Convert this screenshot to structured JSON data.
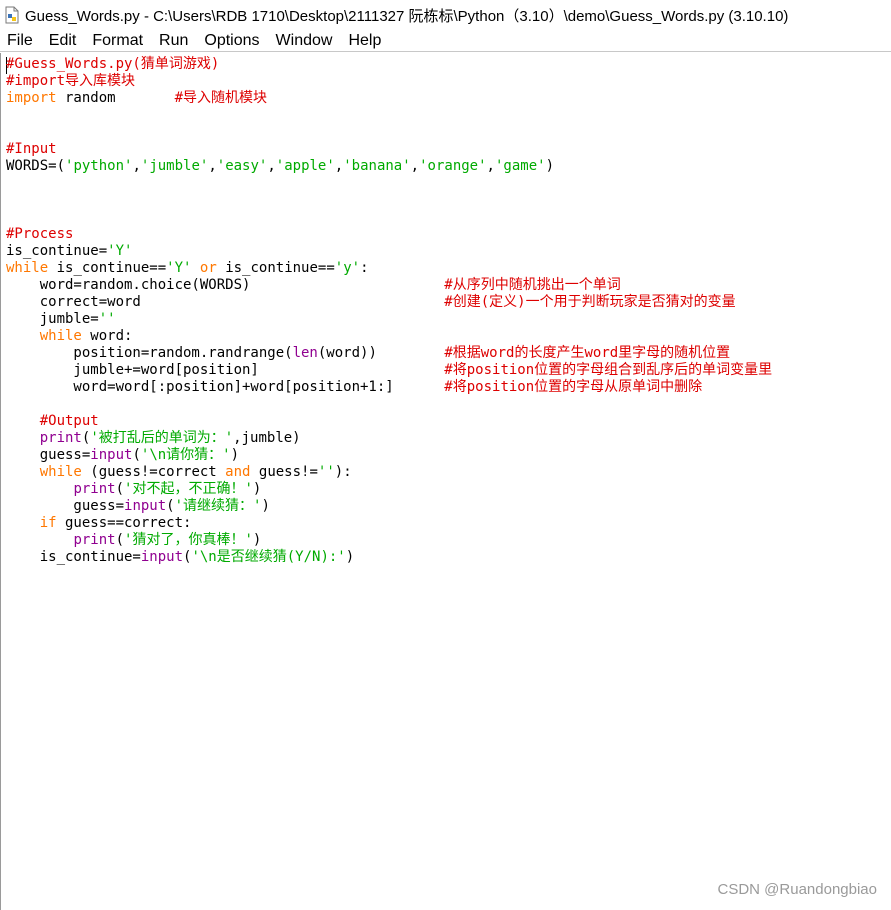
{
  "window": {
    "title": "Guess_Words.py - C:\\Users\\RDB    1710\\Desktop\\2111327 阮栋标\\Python（3.10）\\demo\\Guess_Words.py (3.10.10)",
    "icon": "python-file-icon"
  },
  "menu": [
    "File",
    "Edit",
    "Format",
    "Run",
    "Options",
    "Window",
    "Help"
  ],
  "code_lines": [
    [
      [
        "cm",
        "#Guess_Words.py(猜单词游戏)"
      ]
    ],
    [
      [
        "cm",
        "#import导入库模块"
      ]
    ],
    [
      [
        "kw",
        "import"
      ],
      [
        "df",
        " random       "
      ],
      [
        "cm",
        "#导入随机模块"
      ]
    ],
    [],
    [],
    [
      [
        "cm",
        "#Input"
      ]
    ],
    [
      [
        "df",
        "WORDS=("
      ],
      [
        "st",
        "'python'"
      ],
      [
        "df",
        ","
      ],
      [
        "st",
        "'jumble'"
      ],
      [
        "df",
        ","
      ],
      [
        "st",
        "'easy'"
      ],
      [
        "df",
        ","
      ],
      [
        "st",
        "'apple'"
      ],
      [
        "df",
        ","
      ],
      [
        "st",
        "'banana'"
      ],
      [
        "df",
        ","
      ],
      [
        "st",
        "'orange'"
      ],
      [
        "df",
        ","
      ],
      [
        "st",
        "'game'"
      ],
      [
        "df",
        ")"
      ]
    ],
    [],
    [],
    [],
    [
      [
        "cm",
        "#Process"
      ]
    ],
    [
      [
        "df",
        "is_continue="
      ],
      [
        "st",
        "'Y'"
      ]
    ],
    [
      [
        "kw",
        "while"
      ],
      [
        "df",
        " is_continue=="
      ],
      [
        "st",
        "'Y'"
      ],
      [
        "df",
        " "
      ],
      [
        "kw",
        "or"
      ],
      [
        "df",
        " is_continue=="
      ],
      [
        "st",
        "'y'"
      ],
      [
        "df",
        ":"
      ]
    ],
    [
      [
        "df",
        "    word=random.choice(WORDS)                       "
      ],
      [
        "cm",
        "#从序列中随机挑出一个单词"
      ]
    ],
    [
      [
        "df",
        "    correct=word                                    "
      ],
      [
        "cm",
        "#创建(定义)一个用于判断玩家是否猜对的变量"
      ]
    ],
    [
      [
        "df",
        "    jumble="
      ],
      [
        "st",
        "''"
      ]
    ],
    [
      [
        "df",
        "    "
      ],
      [
        "kw",
        "while"
      ],
      [
        "df",
        " word:"
      ]
    ],
    [
      [
        "df",
        "        position=random.randrange("
      ],
      [
        "bi",
        "len"
      ],
      [
        "df",
        "(word))        "
      ],
      [
        "cm",
        "#根据word的长度产生word里字母的随机位置"
      ]
    ],
    [
      [
        "df",
        "        jumble+=word[position]                      "
      ],
      [
        "cm",
        "#将position位置的字母组合到乱序后的单词变量里"
      ]
    ],
    [
      [
        "df",
        "        word=word[:position]+word[position+1:]      "
      ],
      [
        "cm",
        "#将position位置的字母从原单词中删除"
      ]
    ],
    [],
    [
      [
        "df",
        "    "
      ],
      [
        "cm",
        "#Output"
      ]
    ],
    [
      [
        "df",
        "    "
      ],
      [
        "bi",
        "print"
      ],
      [
        "df",
        "("
      ],
      [
        "st",
        "'被打乱后的单词为：'"
      ],
      [
        "df",
        ",jumble)"
      ]
    ],
    [
      [
        "df",
        "    guess="
      ],
      [
        "bi",
        "input"
      ],
      [
        "df",
        "("
      ],
      [
        "st",
        "'\\n请你猜：'"
      ],
      [
        "df",
        ")"
      ]
    ],
    [
      [
        "df",
        "    "
      ],
      [
        "kw",
        "while"
      ],
      [
        "df",
        " (guess!=correct "
      ],
      [
        "kw",
        "and"
      ],
      [
        "df",
        " guess!="
      ],
      [
        "st",
        "''"
      ],
      [
        "df",
        "):"
      ]
    ],
    [
      [
        "df",
        "        "
      ],
      [
        "bi",
        "print"
      ],
      [
        "df",
        "("
      ],
      [
        "st",
        "'对不起，不正确！'"
      ],
      [
        "df",
        ")"
      ]
    ],
    [
      [
        "df",
        "        guess="
      ],
      [
        "bi",
        "input"
      ],
      [
        "df",
        "("
      ],
      [
        "st",
        "'请继续猜：'"
      ],
      [
        "df",
        ")"
      ]
    ],
    [
      [
        "df",
        "    "
      ],
      [
        "kw",
        "if"
      ],
      [
        "df",
        " guess==correct:"
      ]
    ],
    [
      [
        "df",
        "        "
      ],
      [
        "bi",
        "print"
      ],
      [
        "df",
        "("
      ],
      [
        "st",
        "'猜对了，你真棒！'"
      ],
      [
        "df",
        ")"
      ]
    ],
    [
      [
        "df",
        "    is_continue="
      ],
      [
        "bi",
        "input"
      ],
      [
        "df",
        "("
      ],
      [
        "st",
        "'\\n是否继续猜(Y/N):'"
      ],
      [
        "df",
        ")"
      ]
    ]
  ],
  "colors": {
    "comment": "#dd0000",
    "keyword": "#ff7700",
    "builtin": "#900090",
    "string": "#00aa00",
    "default": "#000000"
  },
  "watermark": "CSDN @Ruandongbiao"
}
